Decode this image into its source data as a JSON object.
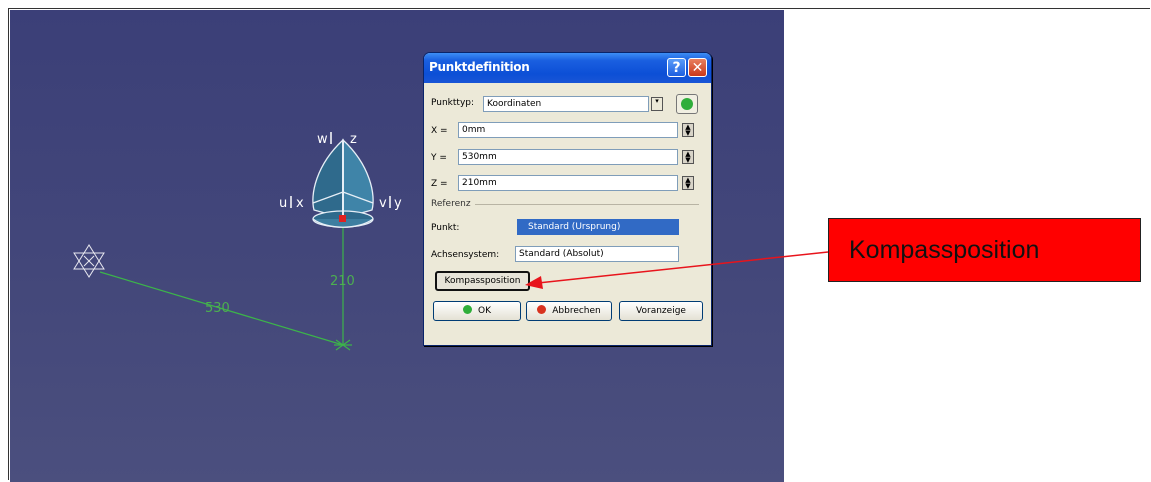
{
  "dialog": {
    "title": "Punktdefinition",
    "help": "?",
    "close": "✕",
    "punkttyp_label": "Punkttyp:",
    "punkttyp_value": "Koordinaten",
    "x_label": "X =",
    "x_value": "0mm",
    "y_label": "Y =",
    "y_value": "530mm",
    "z_label": "Z =",
    "z_value": "210mm",
    "referenz_label": "Referenz",
    "punkt_label": "Punkt:",
    "punkt_value": "Standard (Ursprung)",
    "achsen_label": "Achsensystem:",
    "achsen_value": "Standard (Absolut)",
    "kompass_button": "Kompassposition",
    "ok_button": "OK",
    "abbrechen_button": "Abbrechen",
    "vorschau_button": "Voranzeige"
  },
  "viewport": {
    "dim_530": "530",
    "dim_210": "210",
    "compass_w": "w",
    "compass_z": "z",
    "compass_u": "u",
    "compass_x": "x",
    "compass_v": "v",
    "compass_y": "y"
  },
  "callout": {
    "text": "Kompassposition",
    "color": "#ff0000"
  }
}
